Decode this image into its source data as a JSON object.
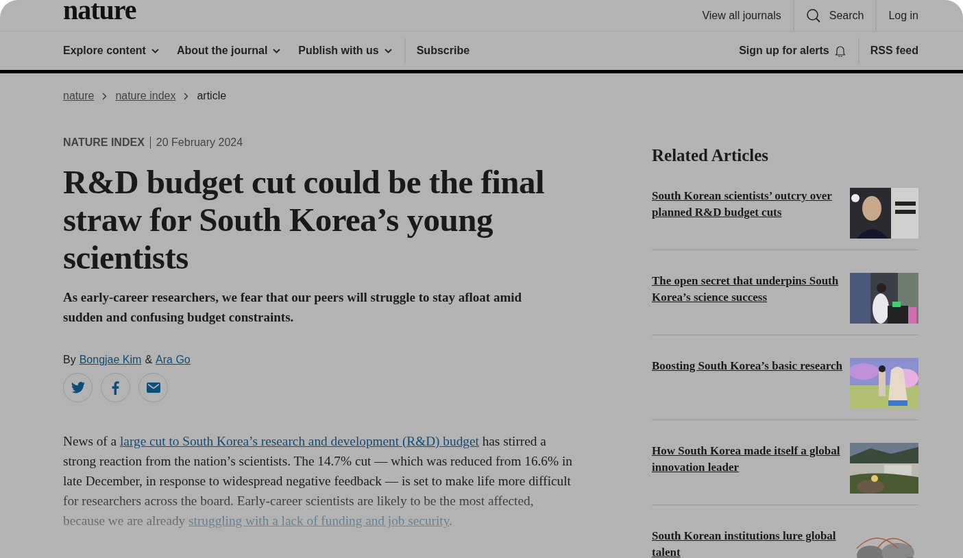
{
  "brand": "nature",
  "top_links": [
    {
      "label": "View all journals",
      "kind": "text"
    },
    {
      "label": "Search",
      "kind": "search"
    },
    {
      "label": "Log in",
      "kind": "text"
    }
  ],
  "nav": [
    {
      "label": "Explore content",
      "kind": "dropdown"
    },
    {
      "label": "About the journal",
      "kind": "dropdown"
    },
    {
      "label": "Publish with us",
      "kind": "dropdown"
    },
    {
      "label": "Subscribe",
      "kind": "link"
    }
  ],
  "nav_right": [
    {
      "label": "Sign up for alerts",
      "kind": "bell"
    },
    {
      "label": "RSS feed",
      "kind": "link"
    }
  ],
  "breadcrumbs": [
    {
      "label": "nature",
      "link": true
    },
    {
      "label": "nature index",
      "link": true
    },
    {
      "label": "article",
      "link": false
    }
  ],
  "article": {
    "section": "NATURE INDEX",
    "date": "20 February 2024",
    "title": "R&D budget cut could be the final straw for South Korea’s young scientists",
    "standfirst": "As early-career researchers, we fear that our peers will struggle to stay afloat amid sudden and confusing budget constraints.",
    "byline_prefix": "By",
    "authors": [
      "Bongjae Kim",
      "Ara Go"
    ],
    "author_joiner": "&",
    "share": [
      {
        "kind": "twitter"
      },
      {
        "kind": "facebook"
      },
      {
        "kind": "email"
      }
    ],
    "body": [
      {
        "text": "News of a ",
        "link": false
      },
      {
        "text": "large cut to South Korea’s research and development (R&D) budget",
        "link": true
      },
      {
        "text": " has stirred a strong reaction from the nation’s scientists. The 14.7% cut — which was reduced from 16.6% in late December, in response to widespread negative feedback — is set to make life more difficult for researchers across the board. Early-career scientists are likely to be the most affected, because we are already ",
        "link": false
      },
      {
        "text": "struggling with a lack of funding and job security",
        "link": true
      },
      {
        "text": ".",
        "link": false
      }
    ]
  },
  "related": {
    "heading": "Related Articles",
    "items": [
      {
        "title": "South Korean scientists’ outcry over planned R&D budget cuts"
      },
      {
        "title": "The open secret that underpins South Korea’s science success"
      },
      {
        "title": "Boosting South Korea’s basic research"
      },
      {
        "title": "How South Korea made itself a global innovation leader"
      },
      {
        "title": "South Korean institutions lure global talent"
      }
    ]
  }
}
